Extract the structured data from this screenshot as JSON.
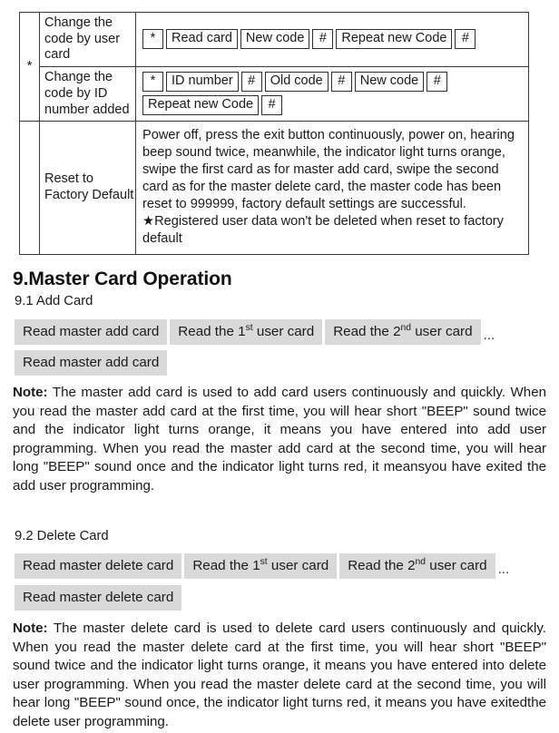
{
  "table": {
    "star_symbol": "*",
    "rows": [
      {
        "label": "Change the code by user card",
        "key_lines": [
          [
            "*",
            "Read card",
            "New code",
            "#",
            "Repeat new Code",
            "#"
          ]
        ]
      },
      {
        "label": "Change the code by ID number added",
        "key_lines": [
          [
            "*",
            "ID number",
            "#",
            "Old code",
            "#",
            "New code",
            "#"
          ],
          [
            "Repeat new Code",
            "#"
          ]
        ]
      },
      {
        "label": "Reset to Factory Default",
        "body": "Power off, press the exit button continuously, power on, hearing beep sound twice, meanwhile, the indicator light turns orange, swipe the first card as for master add card, swipe the second card as for the master delete card, the master code has been reset to 999999, factory default settings are successful.",
        "body_note": "★Registered user data won't be deleted when reset to factory default"
      }
    ]
  },
  "section": {
    "heading": "9.Master Card Operation",
    "add": {
      "subheading": "9.1 Add Card",
      "chips_line1": [
        {
          "text": "Read master add card"
        },
        {
          "pre": "Read the ",
          "sup": "1",
          "sup_suffix": "st",
          "post": " user card"
        },
        {
          "pre": "Read the ",
          "sup": "2",
          "sup_suffix": "nd",
          "post": " user card"
        }
      ],
      "ellipsis": "...",
      "chips_line2": [
        {
          "text": "Read master add card"
        }
      ],
      "note_label": "Note:",
      "note_text": " The master add card is used to add card users continuously and quickly. When you read the master add card at the first time, you will hear short \"BEEP\" sound twice and the indicator light turns orange, it means you have entered into add user programming. When you read the master add card at the second time, you will hear long \"BEEP\" sound once and the indicator light turns red, it means",
      "note_last_line": "you have exited the add user programming."
    },
    "delete": {
      "subheading": "9.2  Delete Card",
      "chips_line1": [
        {
          "text": "Read master delete card"
        },
        {
          "pre": "Read the ",
          "sup": "1",
          "sup_suffix": "st",
          "post": " user card"
        },
        {
          "pre": "Read the ",
          "sup": "2",
          "sup_suffix": "nd",
          "post": " user card"
        }
      ],
      "ellipsis": "...",
      "chips_line2": [
        {
          "text": "Read master delete card"
        }
      ],
      "note_label": "Note:",
      "note_text": " The master delete card is used to delete card users continuously and quickly. When you read the master delete card at the first time, you will hear short \"BEEP\" sound twice and the indicator light turns orange, it means you have entered into delete user programming. When you read the master delete card at the second time, you will hear long \"BEEP\" sound once, the indicator light turns red, it means you have exited",
      "note_last_line": "the delete user programming."
    }
  },
  "colors": {
    "chip_background": "#d9d9d9",
    "table_border": "#3a3a3a",
    "text": "#1a1a1a"
  }
}
